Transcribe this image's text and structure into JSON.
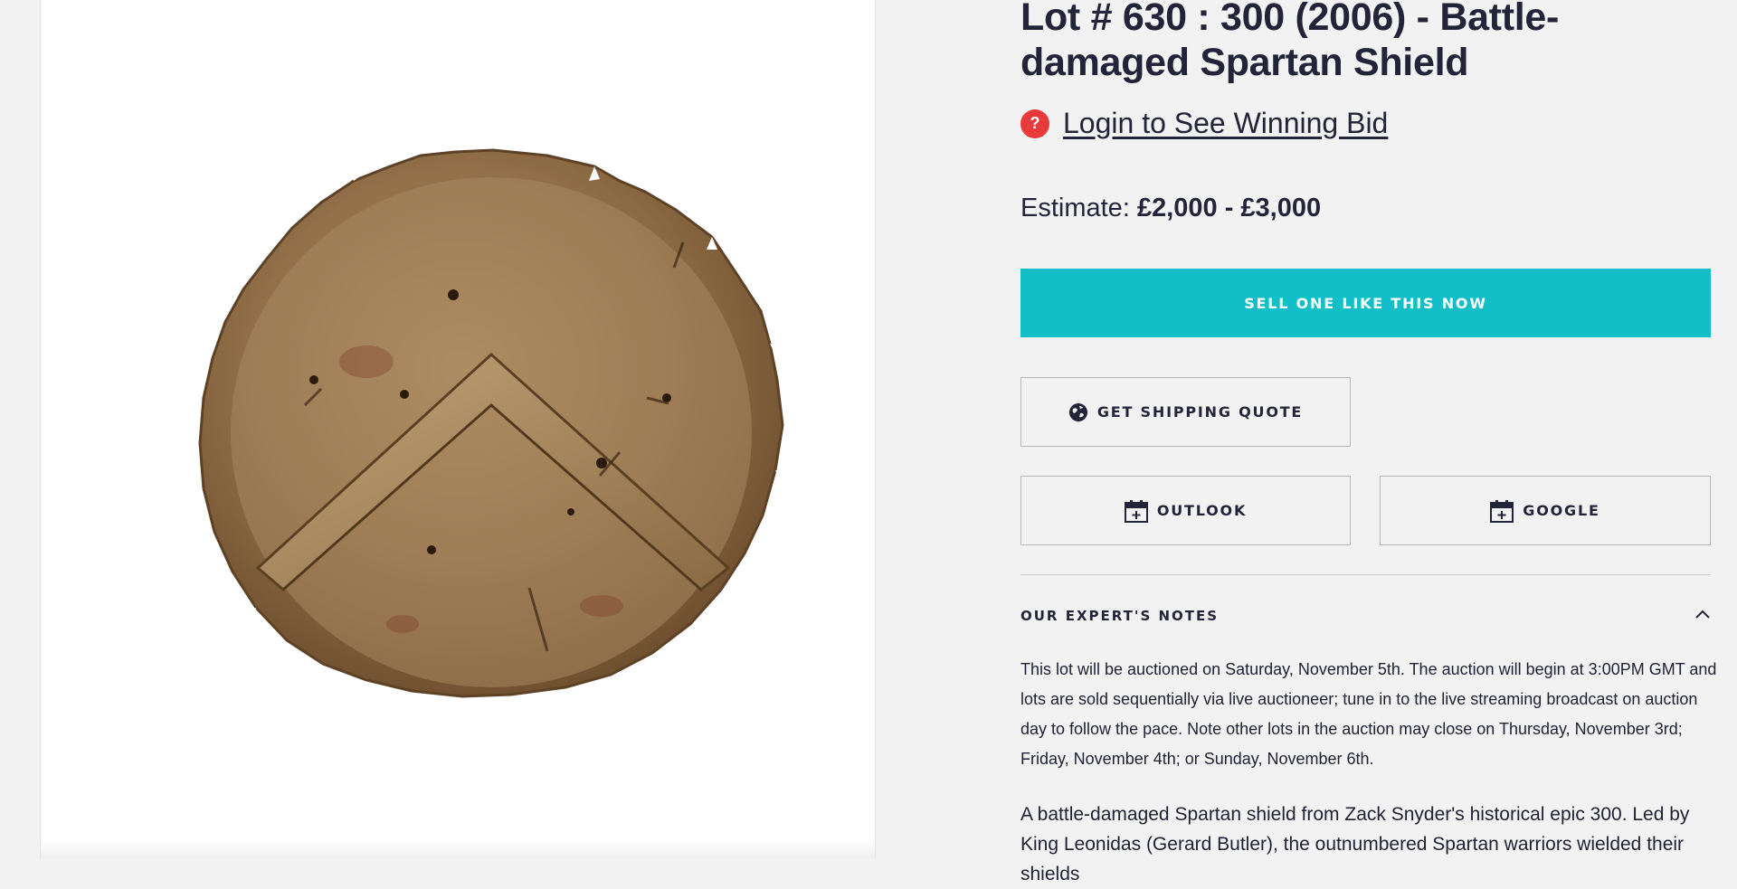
{
  "lot": {
    "title": "Lot # 630 : 300 (2006) - Battle-damaged Spartan Shield",
    "winning_bid_link": "Login to See Winning Bid",
    "estimate_label": "Estimate:",
    "estimate_value": "£2,000 - £3,000"
  },
  "actions": {
    "sell_label": "SELL ONE LIKE THIS NOW",
    "shipping_label": "GET SHIPPING QUOTE",
    "outlook_label": "OUTLOOK",
    "google_label": "GOOGLE"
  },
  "notes": {
    "header": "OUR EXPERT'S NOTES",
    "auction_text": "This lot will be auctioned on Saturday, November 5th. The auction will begin at 3:00PM GMT and lots are sold sequentially via live auctioneer; tune in to the live streaming broadcast on auction day to follow the pace. Note other lots in the auction may close on Thursday, November 3rd; Friday, November 4th; or Sunday, November 6th.",
    "description": "A battle-damaged Spartan shield from Zack Snyder's historical epic 300. Led by King Leonidas (Gerard Butler), the outnumbered Spartan warriors wielded their shields"
  },
  "icons": {
    "help": "question-mark-circle-icon",
    "shipping": "globe-icon",
    "calendar": "calendar-add-icon",
    "collapse": "chevron-up-icon"
  },
  "colors": {
    "accent": "#12bfc8",
    "help_badge": "#e83a3a",
    "text": "#23243a",
    "background": "#f2f2f3"
  }
}
